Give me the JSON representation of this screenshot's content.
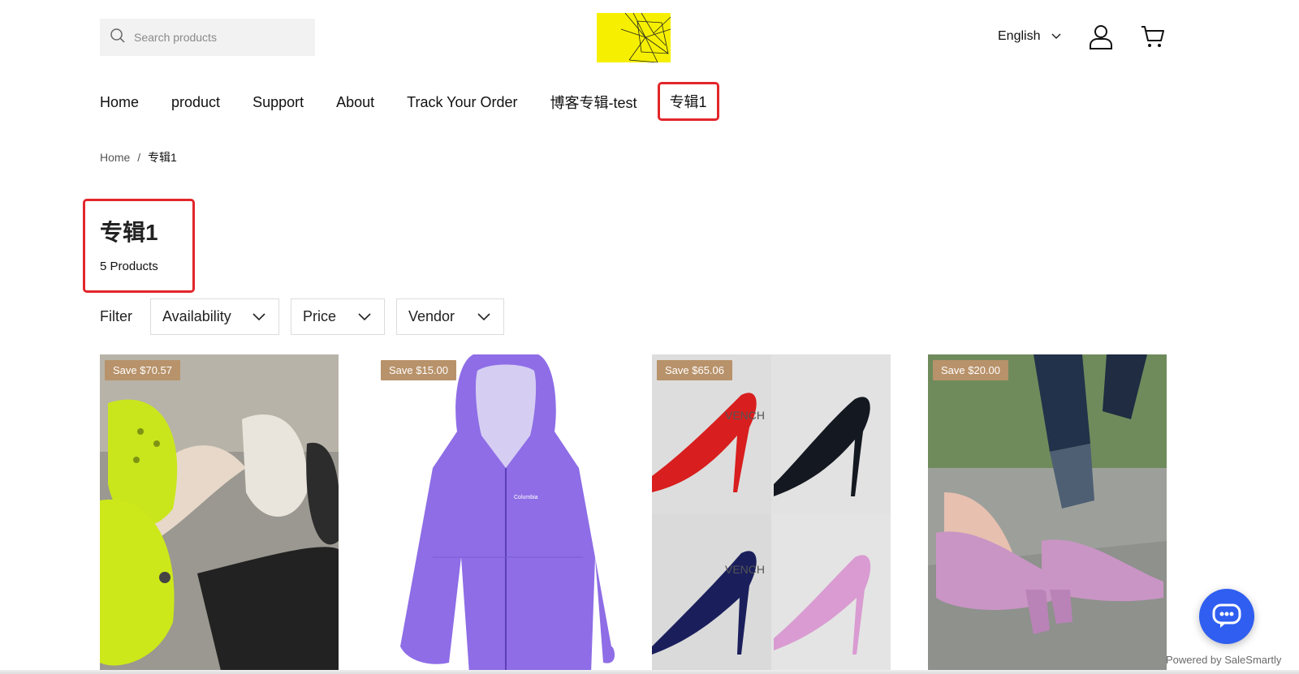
{
  "search": {
    "placeholder": "Search products",
    "icon": "search-icon"
  },
  "header": {
    "language": "English",
    "user_icon": "user-icon",
    "cart_icon": "cart-icon"
  },
  "nav": {
    "items": [
      {
        "label": "Home"
      },
      {
        "label": "product"
      },
      {
        "label": "Support"
      },
      {
        "label": "About"
      },
      {
        "label": "Track Your Order"
      },
      {
        "label": "博客专辑-test"
      },
      {
        "label": "专辑1",
        "active": true
      }
    ]
  },
  "breadcrumb": {
    "home": "Home",
    "separator": "/",
    "current": "专辑1"
  },
  "collection": {
    "title": "专辑1",
    "count": "5 Products"
  },
  "filter": {
    "label": "Filter",
    "options": [
      "Availability",
      "Price",
      "Vendor"
    ]
  },
  "products": [
    {
      "badge": "Save $70.57",
      "image": "crocs-clogs"
    },
    {
      "badge": "Save $15.00",
      "image": "purple-rain-jacket"
    },
    {
      "badge": "Save $65.06",
      "image": "pointed-heels-grid"
    },
    {
      "badge": "Save $20.00",
      "image": "pink-block-heels"
    }
  ],
  "chat": {
    "powered_by": "Powered by SaleSmartly",
    "icon": "chat-icon"
  },
  "colors": {
    "highlight": "#e2262b",
    "badge": "#b8926a",
    "chat": "#2f5ef0",
    "logo": "#f5ef00"
  }
}
